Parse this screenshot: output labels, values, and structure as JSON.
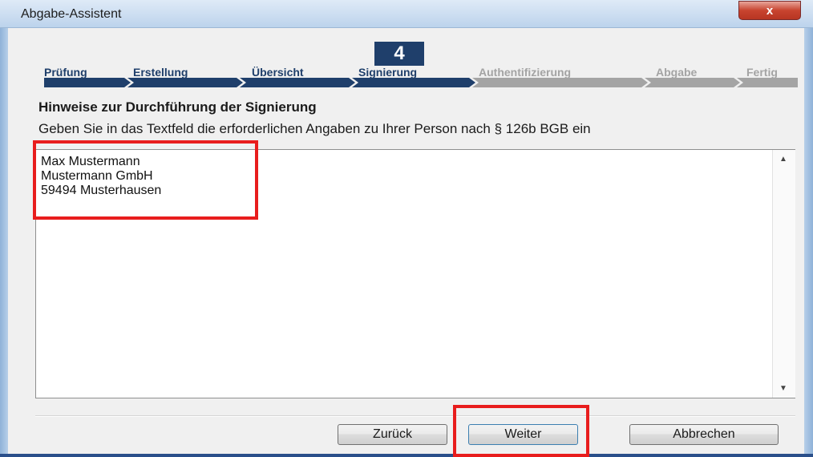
{
  "window": {
    "title": "Abgabe-Assistent",
    "close_label": "x"
  },
  "steps": {
    "current_number": "4",
    "items": [
      {
        "label": "Prüfung",
        "state": "done"
      },
      {
        "label": "Erstellung",
        "state": "done"
      },
      {
        "label": "Übersicht",
        "state": "done"
      },
      {
        "label": "Signierung",
        "state": "active"
      },
      {
        "label": "Authentifizierung",
        "state": "pending"
      },
      {
        "label": "Abgabe",
        "state": "pending"
      },
      {
        "label": "Fertig",
        "state": "pending"
      }
    ]
  },
  "main": {
    "heading": "Hinweise zur Durchführung der Signierung",
    "description": "Geben Sie in das Textfeld die erforderlichen Angaben zu Ihrer Person nach § 126b BGB ein",
    "textarea_lines": [
      "Max Mustermann",
      "Mustermann GmbH",
      "59494 Musterhausen"
    ]
  },
  "buttons": {
    "back": "Zurück",
    "next": "Weiter",
    "cancel": "Abbrechen"
  },
  "colors": {
    "active_step": "#1f3f6b",
    "inactive_step": "#a4a4a4",
    "highlight": "#e81d1d"
  },
  "icons": {
    "close": "close-icon",
    "scroll_up": "scroll-up-arrow-icon",
    "scroll_down": "scroll-down-arrow-icon"
  }
}
